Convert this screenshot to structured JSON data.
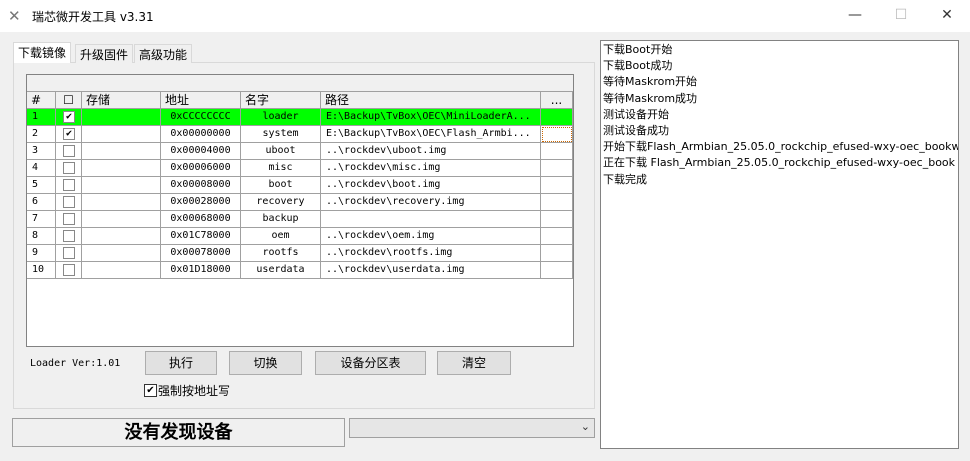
{
  "window": {
    "title": "瑞芯微开发工具 v3.31",
    "minimize": "—",
    "maximize": "☐",
    "close": "✕"
  },
  "tabs": [
    "下载镜像",
    "升级固件",
    "高级功能"
  ],
  "table": {
    "headers": [
      "#",
      "☐",
      "存储",
      "地址",
      "名字",
      "路径",
      "..."
    ],
    "rows": [
      {
        "n": "1",
        "checked": true,
        "storage": "",
        "addr": "0xCCCCCCCC",
        "name": "loader",
        "path": "E:\\Backup\\TvBox\\OEC\\MiniLoaderA...",
        "selected": true
      },
      {
        "n": "2",
        "checked": true,
        "storage": "",
        "addr": "0x00000000",
        "name": "system",
        "path": "E:\\Backup\\TvBox\\OEC\\Flash_Armbi..."
      },
      {
        "n": "3",
        "checked": false,
        "storage": "",
        "addr": "0x00004000",
        "name": "uboot",
        "path": "..\\rockdev\\uboot.img"
      },
      {
        "n": "4",
        "checked": false,
        "storage": "",
        "addr": "0x00006000",
        "name": "misc",
        "path": "..\\rockdev\\misc.img"
      },
      {
        "n": "5",
        "checked": false,
        "storage": "",
        "addr": "0x00008000",
        "name": "boot",
        "path": "..\\rockdev\\boot.img"
      },
      {
        "n": "6",
        "checked": false,
        "storage": "",
        "addr": "0x00028000",
        "name": "recovery",
        "path": "..\\rockdev\\recovery.img"
      },
      {
        "n": "7",
        "checked": false,
        "storage": "",
        "addr": "0x00068000",
        "name": "backup",
        "path": ""
      },
      {
        "n": "8",
        "checked": false,
        "storage": "",
        "addr": "0x01C78000",
        "name": "oem",
        "path": "..\\rockdev\\oem.img"
      },
      {
        "n": "9",
        "checked": false,
        "storage": "",
        "addr": "0x00078000",
        "name": "rootfs",
        "path": "..\\rockdev\\rootfs.img"
      },
      {
        "n": "10",
        "checked": false,
        "storage": "",
        "addr": "0x01D18000",
        "name": "userdata",
        "path": "..\\rockdev\\userdata.img"
      }
    ]
  },
  "loader_ver": "Loader Ver:1.01",
  "buttons": {
    "run": "执行",
    "switch": "切换",
    "partition": "设备分区表",
    "clear": "清空"
  },
  "force_addr": {
    "label": "强制按地址写",
    "checked": true
  },
  "status": "没有发现设备",
  "log": [
    "下载Boot开始",
    "下载Boot成功",
    "等待Maskrom开始",
    "等待Maskrom成功",
    "测试设备开始",
    "测试设备成功",
    "开始下载Flash_Armbian_25.05.0_rockchip_efused-wxy-oec_bookw",
    "正在下载 Flash_Armbian_25.05.0_rockchip_efused-wxy-oec_book",
    "下载完成"
  ],
  "colors": {
    "selected_row": "#00ff00"
  }
}
